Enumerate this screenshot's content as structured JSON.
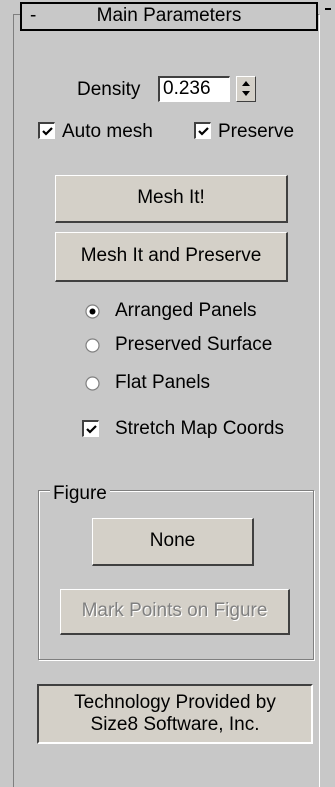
{
  "rollout": {
    "toggle": "-",
    "title": "Main Parameters"
  },
  "density": {
    "label": "Density",
    "value": "0.236"
  },
  "checkboxes": {
    "auto_mesh": {
      "label": "Auto mesh",
      "checked": true
    },
    "preserve": {
      "label": "Preserve",
      "checked": true
    },
    "stretch_map_coords": {
      "label": "Stretch Map Coords",
      "checked": true
    }
  },
  "buttons": {
    "mesh_it": "Mesh It!",
    "mesh_it_preserve": "Mesh It and Preserve"
  },
  "radio": {
    "options": [
      "Arranged Panels",
      "Preserved Surface",
      "Flat Panels"
    ],
    "selected": "Arranged Panels"
  },
  "figure": {
    "group_title": "Figure",
    "none_button": "None",
    "mark_points_button": "Mark Points on Figure"
  },
  "credit": {
    "line1": "Technology Provided by",
    "line2": "Size8 Software, Inc."
  }
}
